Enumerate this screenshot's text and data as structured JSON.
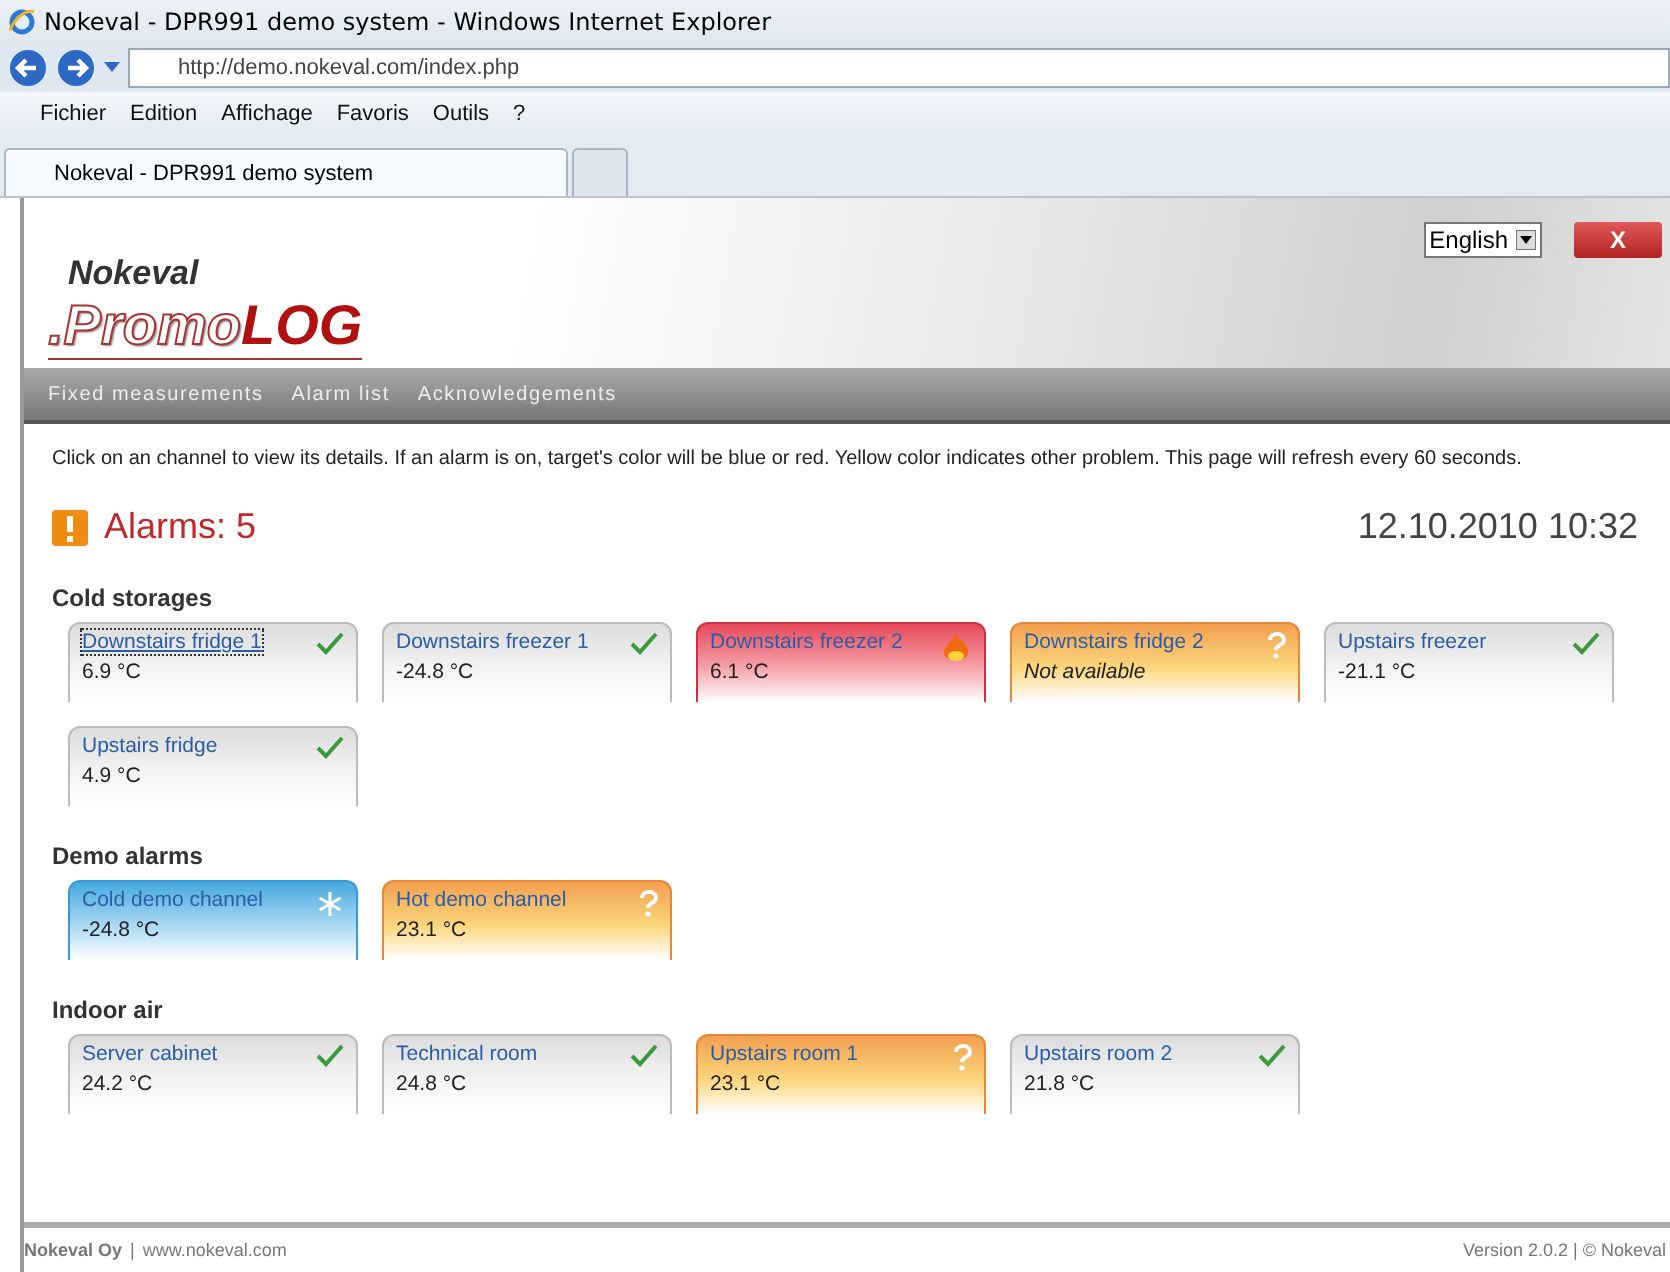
{
  "window": {
    "title": "Nokeval - DPR991 demo system - Windows Internet Explorer"
  },
  "address": "http://demo.nokeval.com/index.php",
  "menu": [
    "Fichier",
    "Edition",
    "Affichage",
    "Favoris",
    "Outils",
    "?"
  ],
  "tabs": [
    {
      "label": "Nokeval - DPR991 demo system",
      "selected": true
    }
  ],
  "logo": {
    "top": "Nokeval",
    "promo": ".Promo",
    "log": "LOG"
  },
  "language": "English",
  "close": "X",
  "nav": [
    "Fixed measurements",
    "Alarm list",
    "Acknowledgements"
  ],
  "info": "Click on an channel to view its details. If an alarm is on, target's color will be blue or red. Yellow color indicates other problem. This page will refresh every 60 seconds.",
  "alarms": "Alarms: 5",
  "datetime": "12.10.2010 10:32",
  "groups": [
    {
      "title": "Cold storages",
      "channels": [
        {
          "name": "Downstairs fridge 1",
          "value": "6.9 °C",
          "kind": "ok",
          "selected": true
        },
        {
          "name": "Downstairs freezer 1",
          "value": "-24.8 °C",
          "kind": "ok",
          "selected": false
        },
        {
          "name": "Downstairs freezer 2",
          "value": "6.1 °C",
          "kind": "hot",
          "selected": false
        },
        {
          "name": "Downstairs fridge 2",
          "value": "Not available",
          "kind": "unknown",
          "selected": false,
          "available": false
        },
        {
          "name": "Upstairs freezer",
          "value": "-21.1 °C",
          "kind": "ok",
          "selected": false
        },
        {
          "name": "Upstairs fridge",
          "value": "4.9 °C",
          "kind": "ok",
          "selected": false
        }
      ]
    },
    {
      "title": "Demo alarms",
      "channels": [
        {
          "name": "Cold demo channel",
          "value": "-24.8 °C",
          "kind": "cold",
          "selected": false
        },
        {
          "name": "Hot demo channel",
          "value": "23.1 °C",
          "kind": "unknown",
          "selected": false
        }
      ]
    },
    {
      "title": "Indoor air",
      "channels": [
        {
          "name": "Server cabinet",
          "value": "24.2 °C",
          "kind": "ok",
          "selected": false
        },
        {
          "name": "Technical room",
          "value": "24.8 °C",
          "kind": "ok",
          "selected": false
        },
        {
          "name": "Upstairs room 1",
          "value": "23.1 °C",
          "kind": "unknown",
          "selected": false
        },
        {
          "name": "Upstairs room 2",
          "value": "21.8 °C",
          "kind": "ok",
          "selected": false
        }
      ]
    }
  ],
  "footer": {
    "company": "Nokeval Oy",
    "separator": "|",
    "site": "www.nokeval.com",
    "version": "Version 2.0.2 | © Nokeval"
  }
}
